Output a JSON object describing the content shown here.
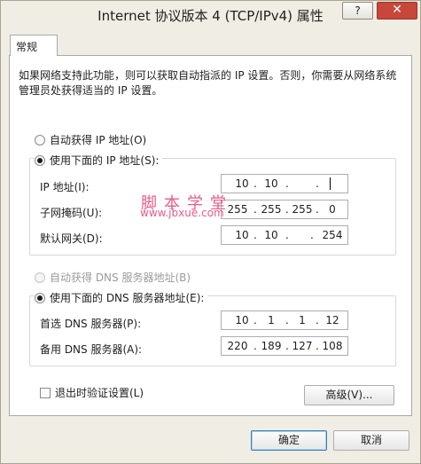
{
  "window": {
    "title": "Internet 协议版本 4 (TCP/IPv4) 属性",
    "help_label": "?",
    "close_label": "✕"
  },
  "tabs": [
    {
      "label": "常规"
    }
  ],
  "description": "如果网络支持此功能，则可以获取自动指派的 IP 设置。否则，你需要从网络系统管理员处获得适当的 IP 设置。",
  "ip_mode": {
    "auto_label": "自动获得 IP 地址(O)",
    "manual_label": "使用下面的 IP 地址(S):",
    "selected": "manual"
  },
  "ip_fields": {
    "ip_address": {
      "label": "IP 地址(I):",
      "segments": [
        "10",
        "10",
        "",
        ""
      ]
    },
    "subnet_mask": {
      "label": "子网掩码(U):",
      "segments": [
        "255",
        "255",
        "255",
        "0"
      ]
    },
    "gateway": {
      "label": "默认网关(D):",
      "segments": [
        "10",
        "10",
        "",
        "254"
      ]
    }
  },
  "dns_mode": {
    "auto_label": "自动获得 DNS 服务器地址(B)",
    "manual_label": "使用下面的 DNS 服务器地址(E):",
    "selected": "manual"
  },
  "dns_fields": {
    "preferred": {
      "label": "首选 DNS 服务器(P):",
      "segments": [
        "10",
        "1",
        "1",
        "12"
      ]
    },
    "alternate": {
      "label": "备用 DNS 服务器(A):",
      "segments": [
        "220",
        "189",
        "127",
        "108"
      ]
    }
  },
  "validate_on_exit": {
    "label": "退出时验证设置(L)",
    "checked": false
  },
  "buttons": {
    "advanced": "高级(V)...",
    "ok": "确定",
    "cancel": "取消"
  },
  "watermark": {
    "chars": "脚本学堂",
    "url": "www.jbxue.com"
  },
  "colors": {
    "window_bg": "#f0ede4",
    "close_red": "#c7473a",
    "watermark_pink": "#e85a88"
  }
}
